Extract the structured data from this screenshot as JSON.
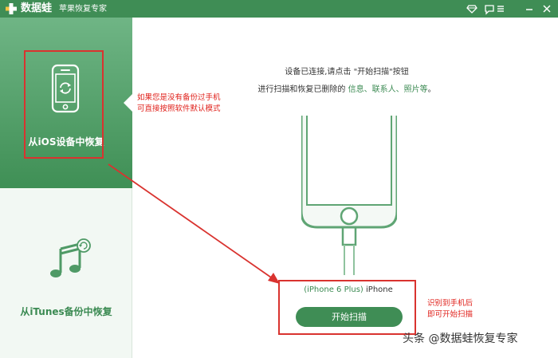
{
  "titlebar": {
    "app_name": "数据蛙",
    "app_subtitle": "苹果恢复专家"
  },
  "sidebar": {
    "items": [
      {
        "label": "从iOS设备中恢复",
        "active": true
      },
      {
        "label": "从iTunes备份中恢复",
        "active": false
      }
    ]
  },
  "main": {
    "instruction_line1": "设备已连接,请点击 \"开始扫描\"按钮",
    "instruction_line2_prefix": "进行扫描和恢复已删除的 ",
    "instruction_categories": "信息、联系人、照片等",
    "instruction_line2_suffix": "。",
    "device_model": "(iPhone 6 Plus)",
    "device_name": "iPhone",
    "scan_button_label": "开始扫描"
  },
  "annotations": {
    "note1_line1": "如果您是没有备份过手机",
    "note1_line2": "可直接按照软件默认模式",
    "note2_line1": "识别到手机后",
    "note2_line2": "即可开始扫描"
  },
  "watermark": "头条 @数据蛙恢复专家",
  "colors": {
    "brand_green": "#3f8d55",
    "annotation_red": "#d9332f"
  }
}
